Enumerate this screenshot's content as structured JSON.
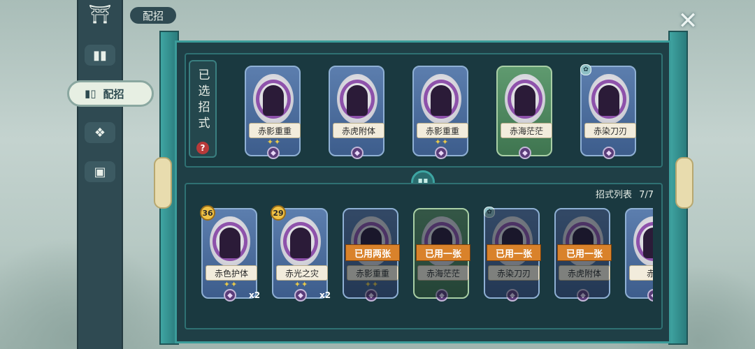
{
  "header": {
    "title": "配招",
    "close_label": "✕"
  },
  "sidebar": {
    "items": [
      {
        "name": "home",
        "icon": "pavilion-icon"
      },
      {
        "name": "cards",
        "icon": "cards-icon"
      },
      {
        "name": "loadout",
        "icon": "card-hand-icon",
        "label": "配招",
        "active": true
      },
      {
        "name": "skills",
        "icon": "lotus-icon"
      },
      {
        "name": "single",
        "icon": "card-icon"
      }
    ]
  },
  "selected": {
    "label": "已选招式",
    "help_label": "?",
    "cards": [
      {
        "name": "赤影重重",
        "stars": "✦✦",
        "color": "blue"
      },
      {
        "name": "赤虎附体",
        "stars": "",
        "color": "blue"
      },
      {
        "name": "赤影重重",
        "stars": "✦✦",
        "color": "blue"
      },
      {
        "name": "赤海茫茫",
        "stars": "",
        "color": "green"
      },
      {
        "name": "赤染刀刃",
        "stars": "",
        "color": "blue",
        "corner": true
      }
    ]
  },
  "list": {
    "title": "招式列表",
    "count": "7/7",
    "cards": [
      {
        "name": "赤色护体",
        "stars": "✦✦",
        "badge": "36",
        "count": "x2",
        "color": "blue"
      },
      {
        "name": "赤光之灾",
        "stars": "✦✦",
        "badge": "29",
        "count": "x2",
        "color": "blue"
      },
      {
        "name": "赤影重重",
        "stars": "✦✦",
        "used": "已用两张",
        "color": "blue"
      },
      {
        "name": "赤海茫茫",
        "stars": "",
        "used": "已用一张",
        "color": "green"
      },
      {
        "name": "赤染刀刃",
        "stars": "",
        "used": "已用一张",
        "color": "blue",
        "corner": true
      },
      {
        "name": "赤虎附体",
        "stars": "",
        "used": "已用一张",
        "color": "blue"
      },
      {
        "name": "赤魔",
        "stars": "",
        "color": "blue"
      }
    ]
  },
  "colors": {
    "panel": "#1f3f46",
    "frame": "#3b9c9a",
    "used_tag": "#d9822b",
    "badge": "#f0c245"
  }
}
